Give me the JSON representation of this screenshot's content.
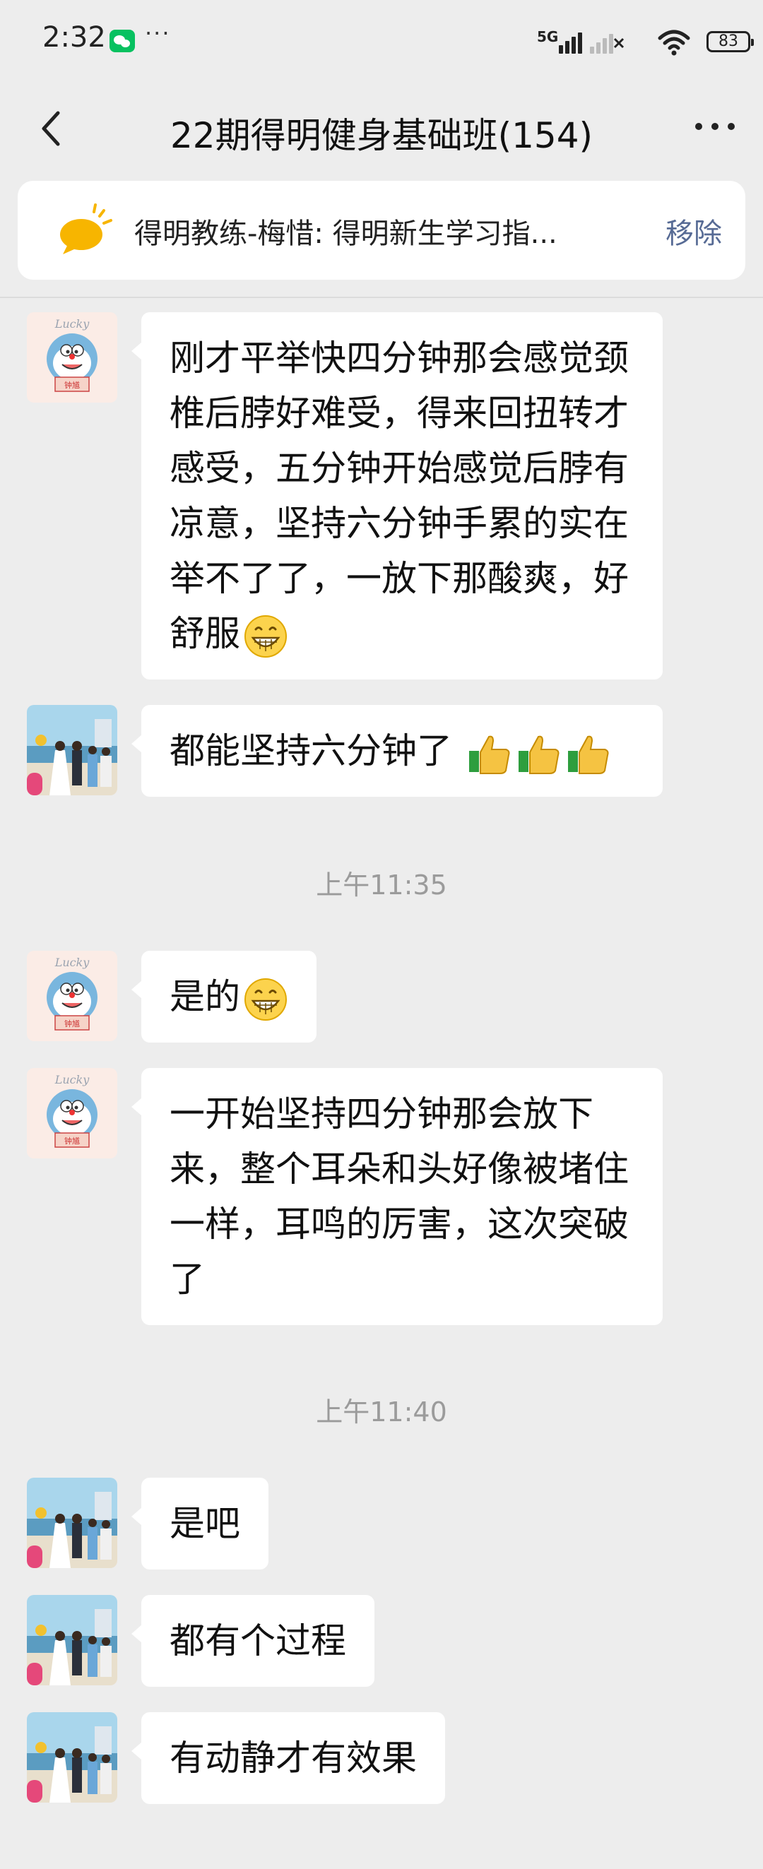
{
  "status_bar": {
    "time": "2:32",
    "network": "5G",
    "battery": "83"
  },
  "header": {
    "title": "22期得明健身基础班(154)"
  },
  "pinned": {
    "text": "得明教练-梅惜: 得明新生学习指...",
    "remove_label": "移除"
  },
  "messages": [
    {
      "sender": "lucky-doraemon",
      "text": "刚才平举快四分钟那会感觉颈椎后脖好难受，得来回扭转才感受，五分钟开始感觉后脖有凉意，坚持六分钟手累的实在举不了了，一放下那酸爽，好舒服",
      "emoji": "grin"
    },
    {
      "sender": "wedding-photo",
      "text": "都能坚持六分钟了",
      "emoji": "thumbs-up-x3"
    },
    {
      "sender": "lucky-doraemon",
      "text": "是的",
      "emoji": "grin"
    },
    {
      "sender": "lucky-doraemon",
      "text": "一开始坚持四分钟那会放下来，整个耳朵和头好像被堵住一样，耳鸣的厉害，这次突破了"
    },
    {
      "sender": "wedding-photo",
      "text": "是吧"
    },
    {
      "sender": "wedding-photo",
      "text": "都有个过程"
    },
    {
      "sender": "wedding-photo",
      "text": "有动静才有效果"
    }
  ],
  "timestamps": [
    "上午11:35",
    "上午11:40"
  ],
  "avatar_labels": {
    "lucky": "Lucky",
    "seal": "钟馗"
  },
  "colors": {
    "background": "#ededed",
    "bubble": "#ffffff",
    "link": "#576b95",
    "wechat_green": "#07c160",
    "timestamp": "#9b9b9b"
  }
}
